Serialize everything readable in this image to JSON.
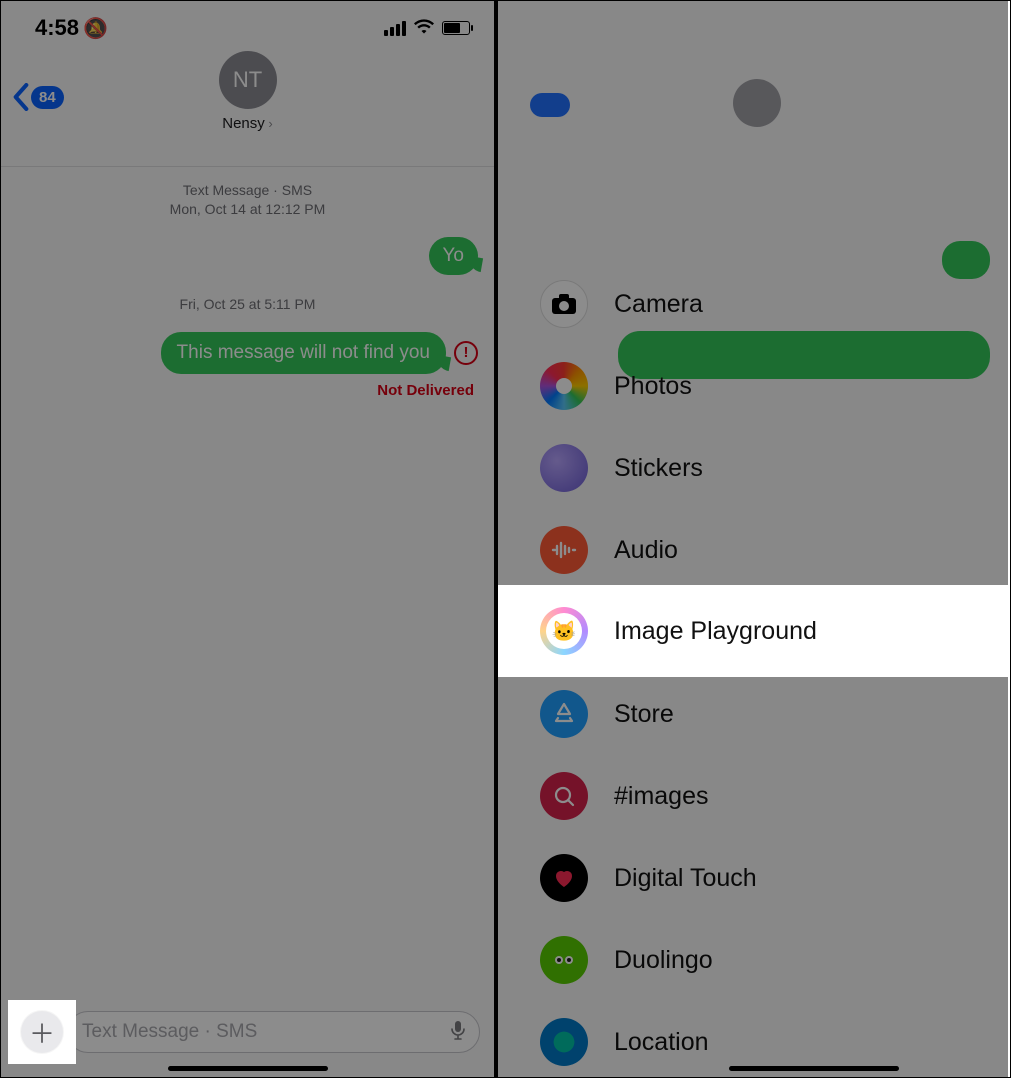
{
  "left": {
    "status": {
      "time": "4:58",
      "bell_icon": "bell-slash"
    },
    "nav": {
      "back_count": "84",
      "contact_initials": "NT",
      "contact_name": "Nensy"
    },
    "thread": {
      "meta1_line1": "Text Message · SMS",
      "meta1_line2": "Mon, Oct 14 at 12:12 PM",
      "msg1": "Yo",
      "meta2": "Fri, Oct 25 at 5:11 PM",
      "msg2": "This message will not find you",
      "error_label": "Not Delivered"
    },
    "input": {
      "placeholder": "Text Message · SMS"
    }
  },
  "right": {
    "menu": {
      "camera": "Camera",
      "photos": "Photos",
      "stickers": "Stickers",
      "audio": "Audio",
      "playground": "Image Playground",
      "store": "Store",
      "images": "#images",
      "digital": "Digital Touch",
      "duolingo": "Duolingo",
      "location": "Location"
    }
  }
}
